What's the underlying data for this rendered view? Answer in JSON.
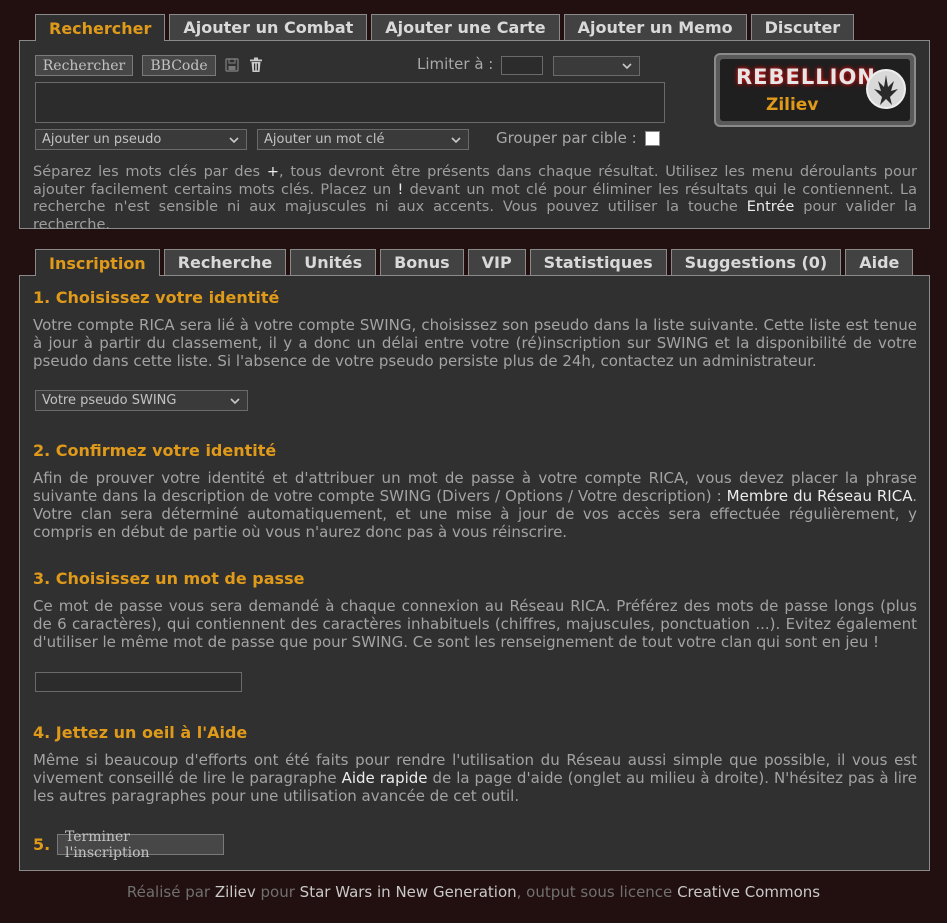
{
  "top_tabs": [
    "Rechercher",
    "Ajouter un Combat",
    "Ajouter une Carte",
    "Ajouter un Memo",
    "Discuter"
  ],
  "search": {
    "search_button": "Rechercher",
    "bbcode_button": "BBCode",
    "limit_label": "Limiter à :",
    "pseudo_select": "Ajouter un pseudo",
    "keyword_select": "Ajouter un mot clé",
    "group_label": "Grouper par cible :",
    "help": {
      "t1": "Séparez les mots clés par des ",
      "plus": "+",
      "t2": ", tous devront être présents dans chaque résultat. Utilisez les menu déroulants pour ajouter facilement certains mots clés. Placez un ",
      "bang": "!",
      "t3": " devant un mot clé pour éliminer les résultats qui le contiennent. La recherche n'est sensible ni aux majuscules ni aux accents. Vous pouvez utiliser la touche ",
      "enter": "Entrée",
      "t4": " pour valider la recherche."
    }
  },
  "logo": {
    "word": "REBELLION",
    "user": "Ziliev"
  },
  "main_tabs": [
    "Inscription",
    "Recherche",
    "Unités",
    "Bonus",
    "VIP",
    "Statistiques",
    "Suggestions (0)",
    "Aide"
  ],
  "steps": {
    "s1": {
      "title": "1. Choisissez votre identité",
      "text": "Votre compte RICA sera lié à votre compte SWING, choisissez son pseudo dans la liste suivante. Cette liste est tenue à jour à partir du classement, il y a donc un délai entre votre (ré)inscription sur SWING et la disponibilité de votre pseudo dans cette liste. Si l'absence de votre pseudo persiste plus de 24h, contactez un administrateur.",
      "select": "Votre pseudo SWING"
    },
    "s2": {
      "title": "2. Confirmez votre identité",
      "t1": "Afin de prouver votre identité et d'attribuer un mot de passe à votre compte RICA, vous devez placer la phrase suivante dans la description de votre compte SWING (Divers / Options / Votre description) : ",
      "phrase": "Membre du Réseau RICA",
      "t2": ". Votre clan sera déterminé automatiquement, et une mise à jour de vos accès sera effectuée régulièrement, y compris en début de partie où vous n'aurez donc pas à vous réinscrire."
    },
    "s3": {
      "title": "3. Choisissez un mot de passe",
      "text": "Ce mot de passe vous sera demandé à chaque connexion au Réseau RICA. Préférez des mots de passe longs (plus de 6 caractères), qui contiennent des caractères inhabituels (chiffres, majuscules, ponctuation ...). Evitez également d'utiliser le même mot de passe que pour SWING. Ce sont les renseignement de tout votre clan qui sont en jeu !"
    },
    "s4": {
      "title": "4. Jettez un oeil à l'Aide",
      "t1": "Même si beaucoup d'efforts ont été faits pour rendre l'utilisation du Réseau aussi simple que possible, il vous est vivement conseillé de lire le paragraphe ",
      "link": "Aide rapide",
      "t2": " de la page d'aide (onglet au milieu à droite). N'hésitez pas à lire les autres paragraphes pour une utilisation avancée de cet outil."
    },
    "s5": {
      "number": "5.",
      "button": "Terminer l'inscription"
    }
  },
  "footer": {
    "t1": "Réalisé par ",
    "author": "Ziliev",
    "t2": " pour ",
    "game": "Star Wars in New Generation",
    "t3": ", output sous licence ",
    "license": "Creative Commons"
  },
  "colors": {
    "accent": "#e09a1a",
    "background": "#220f0f",
    "panel": "#303030"
  }
}
